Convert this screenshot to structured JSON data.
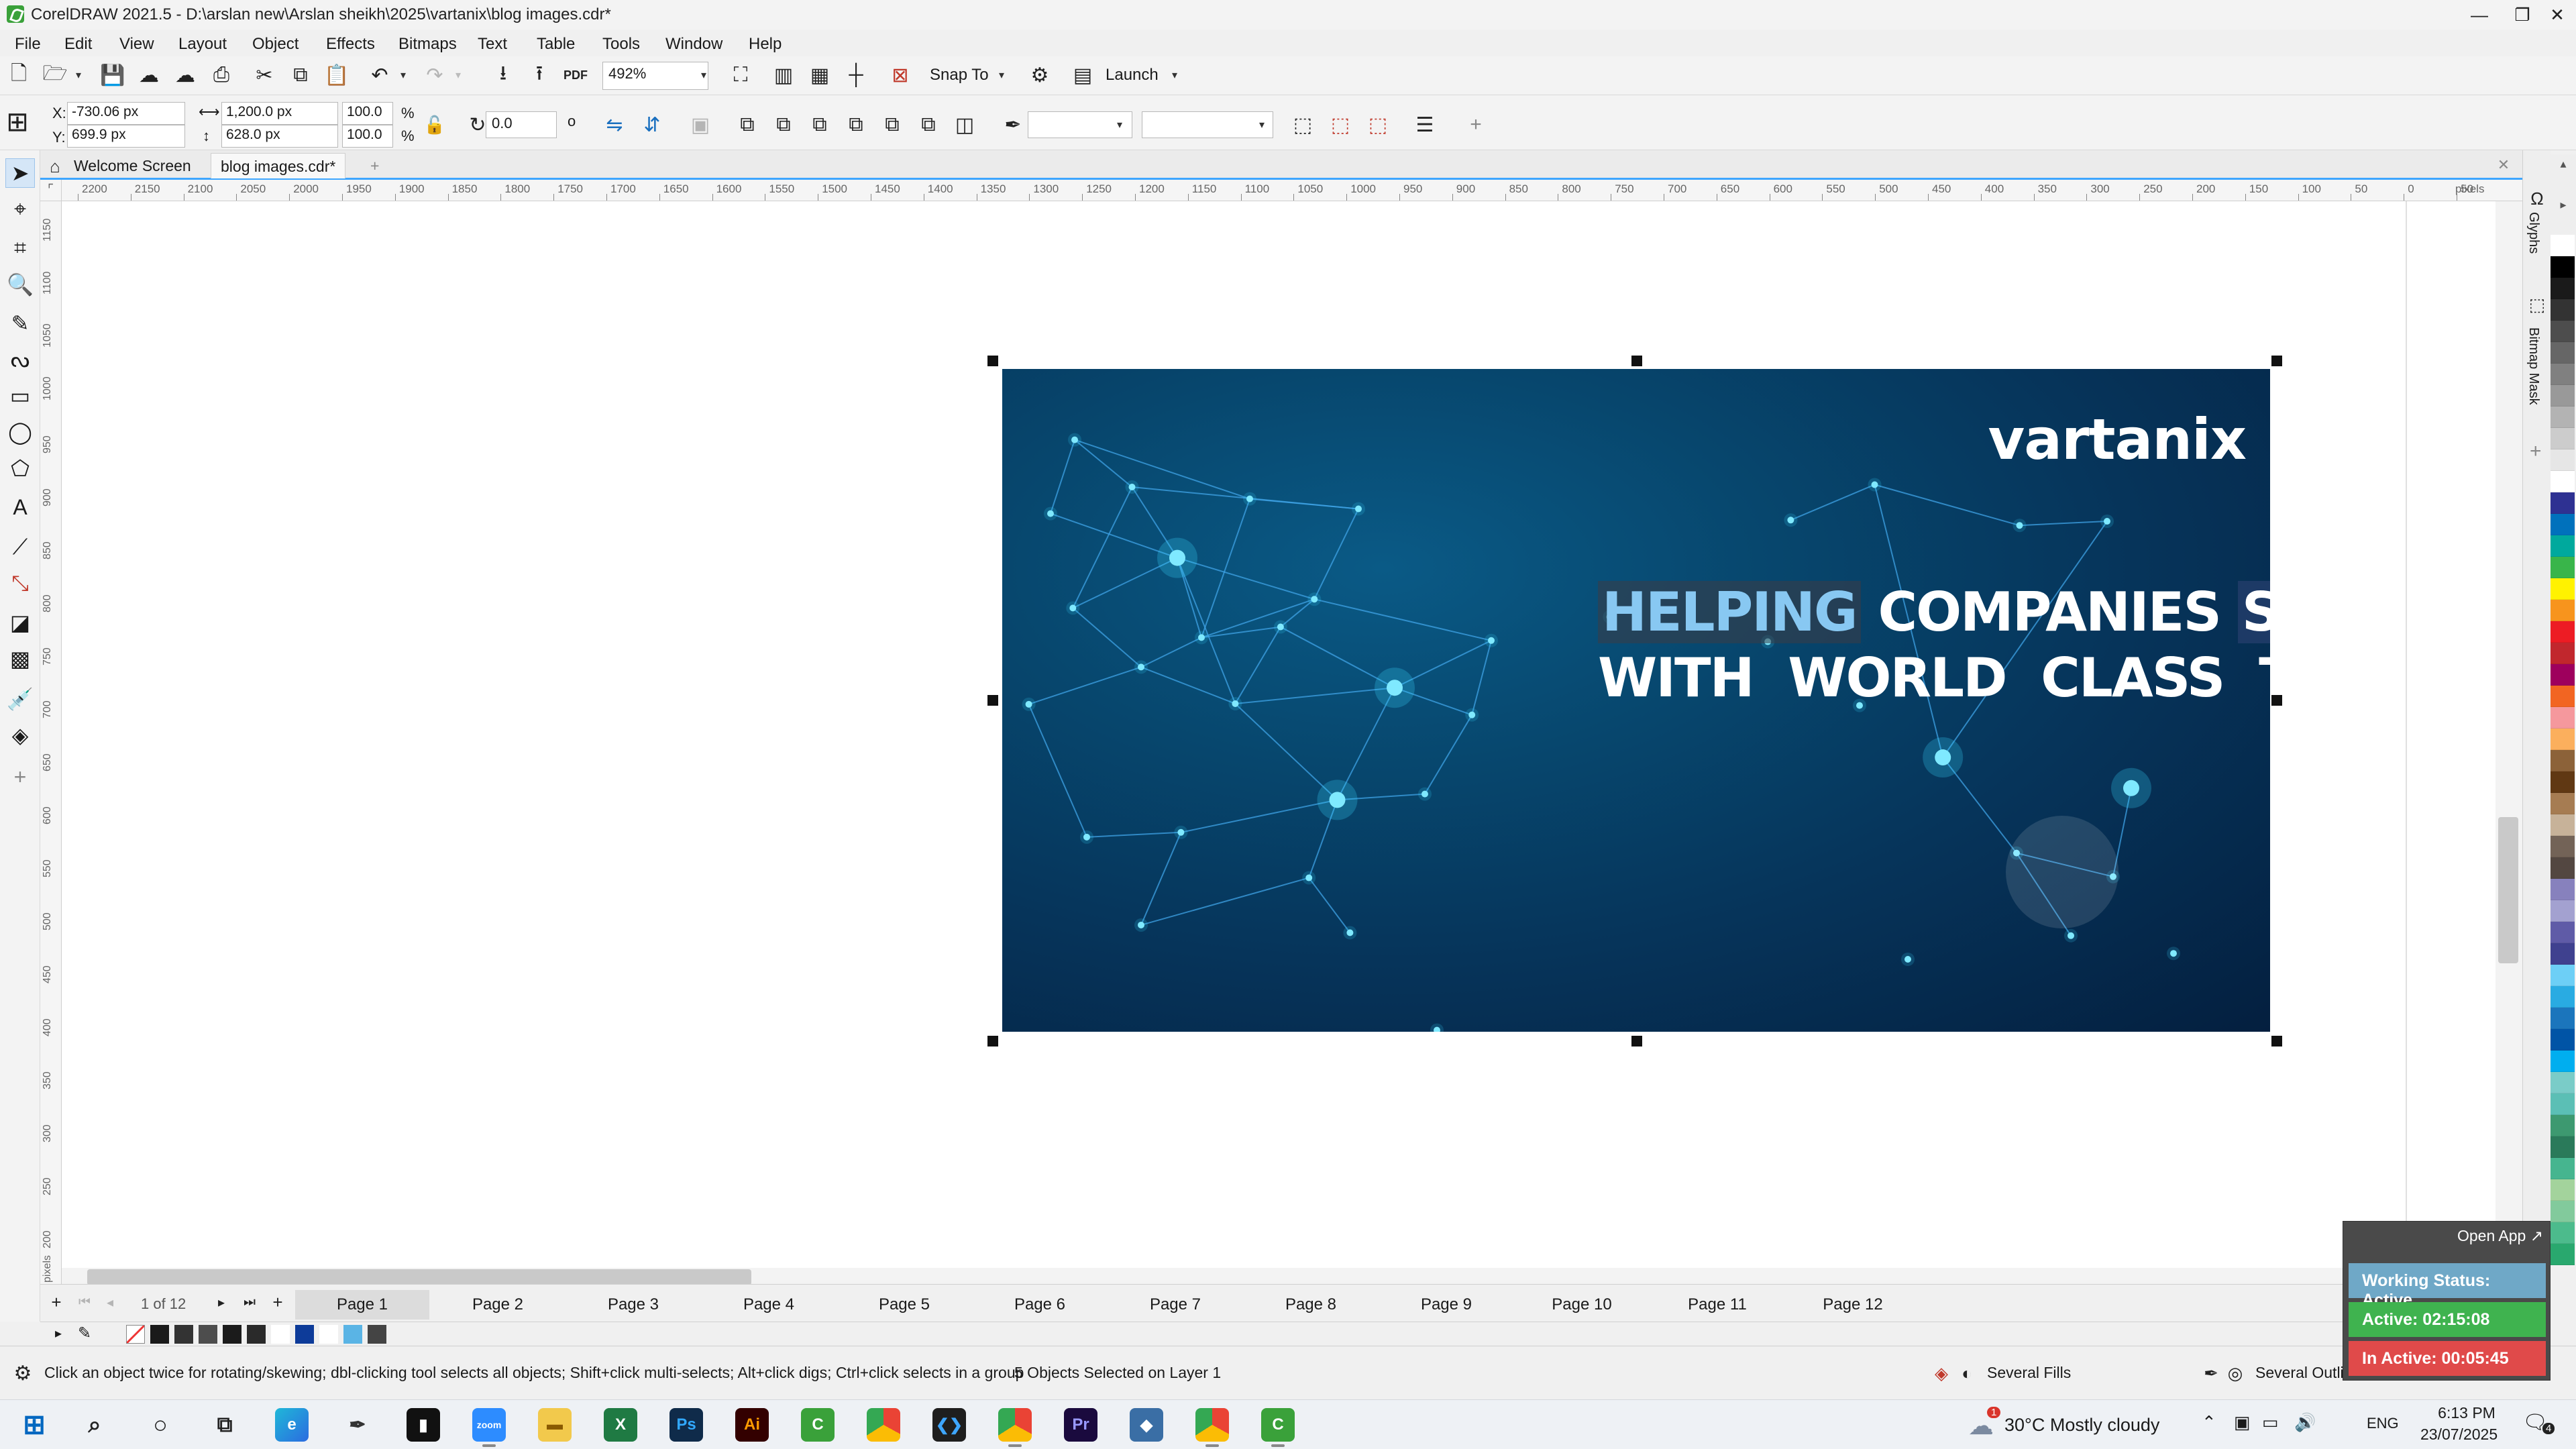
{
  "window": {
    "title": "CorelDRAW 2021.5 - D:\\arslan new\\Arslan sheikh\\2025\\vartanix\\blog images.cdr*",
    "minimize": "—",
    "maximize": "❐",
    "close": "✕"
  },
  "menu": [
    "File",
    "Edit",
    "View",
    "Layout",
    "Object",
    "Effects",
    "Bitmaps",
    "Text",
    "Table",
    "Tools",
    "Window",
    "Help"
  ],
  "toolbar": {
    "zoom": "492%",
    "snap_to": "Snap To",
    "launch": "Launch"
  },
  "properties": {
    "x_label": "X:",
    "x_value": "-730.06 px",
    "y_label": "Y:",
    "y_value": "699.9 px",
    "width_value": "1,200.0 px",
    "height_value": "628.0 px",
    "scale_w": "100.0",
    "scale_h": "100.0",
    "percent": "%",
    "rotation": "0.0",
    "degree": "o"
  },
  "doc_tabs": {
    "welcome": "Welcome Screen",
    "active": "blog images.cdr*",
    "add": "+"
  },
  "ruler": {
    "h_ticks": [
      "2200",
      "2150",
      "2100",
      "2050",
      "2000",
      "1950",
      "1900",
      "1850",
      "1800",
      "1750",
      "1700",
      "1650",
      "1600",
      "1550",
      "1500",
      "1450",
      "1400",
      "1350",
      "1300",
      "1250",
      "1200",
      "1150",
      "1100",
      "1050",
      "1000",
      "950",
      "900",
      "850",
      "800",
      "750",
      "700",
      "650",
      "600",
      "550",
      "500",
      "450",
      "400",
      "350",
      "300",
      "250",
      "200",
      "150",
      "100",
      "50",
      "0",
      "50"
    ],
    "h_unit": "pixels",
    "v_ticks": [
      "1150",
      "1100",
      "1050",
      "1000",
      "950",
      "900",
      "850",
      "800",
      "750",
      "700",
      "650",
      "600",
      "550",
      "500",
      "450",
      "400",
      "350",
      "300",
      "250",
      "200"
    ],
    "v_unit": "pixels"
  },
  "banner": {
    "logo": "vartani",
    "logo_x": "x",
    "headline_line1_word1": "HELPING",
    "headline_line1_word2": "COMPANIES",
    "headline_line1_word3": "SCALE",
    "headline_line2": "WITH  WORLD  CLASS  TECH"
  },
  "dockers": {
    "glyphs": "Glyphs",
    "bitmap_mask": "Bitmap Mask",
    "add": "+"
  },
  "palette_colors": [
    "#ffffff",
    "#000000",
    "#1a1a1a",
    "#333333",
    "#4d4d4d",
    "#666666",
    "#808080",
    "#999999",
    "#b3b3b3",
    "#cccccc",
    "#e6e6e6",
    "#ffffff",
    "#2e3192",
    "#0071bc",
    "#00a99d",
    "#39b54a",
    "#fff200",
    "#f7941d",
    "#ed1c24",
    "#c1272d",
    "#9e005d",
    "#f26522",
    "#f5989d",
    "#fbaf5d",
    "#8c6239",
    "#603813",
    "#a67c52",
    "#c7b299",
    "#736357",
    "#534741",
    "#8781bd",
    "#a3a1d0",
    "#5f5ba7",
    "#3f418f",
    "#6dcff6",
    "#29abe2",
    "#1b75bc",
    "#0054a6",
    "#00aeef",
    "#7accc8",
    "#5bbfb5",
    "#3d9970",
    "#2a7a5a",
    "#46b58f",
    "#a3d39c",
    "#82ca9c",
    "#4cbb8c",
    "#29a86e"
  ],
  "pages": {
    "counter": "1 of 12",
    "tabs": [
      "Page 1",
      "Page 2",
      "Page 3",
      "Page 4",
      "Page 5",
      "Page 6",
      "Page 7",
      "Page 8",
      "Page 9",
      "Page 10",
      "Page 11",
      "Page 12"
    ]
  },
  "doc_palette": [
    "#ffffff",
    "#1a1a1a",
    "#333333",
    "#4d4d4d",
    "#1b1b1b",
    "#2a2a2a",
    "#ffffff",
    "#0d3b99",
    "#ffffff",
    "#5ab4e5",
    "#444444"
  ],
  "status": {
    "hint": "Click an object twice for rotating/skewing; dbl-clicking tool selects all objects; Shift+click multi-selects; Alt+click digs; Ctrl+click selects in a group",
    "selection": "5 Objects Selected on Layer 1",
    "fills": "Several Fills",
    "outlines": "Several Outlines"
  },
  "tracker": {
    "open_app": "Open App ↗",
    "working_status": "Working Status: Active",
    "active": "Active: 02:15:08",
    "inactive": "In Active: 00:05:45"
  },
  "taskbar": {
    "weather_badge": "1",
    "weather": "30°C  Mostly cloudy",
    "lang": "ENG",
    "time": "6:13 PM",
    "date": "23/07/2025",
    "notif": "4"
  }
}
